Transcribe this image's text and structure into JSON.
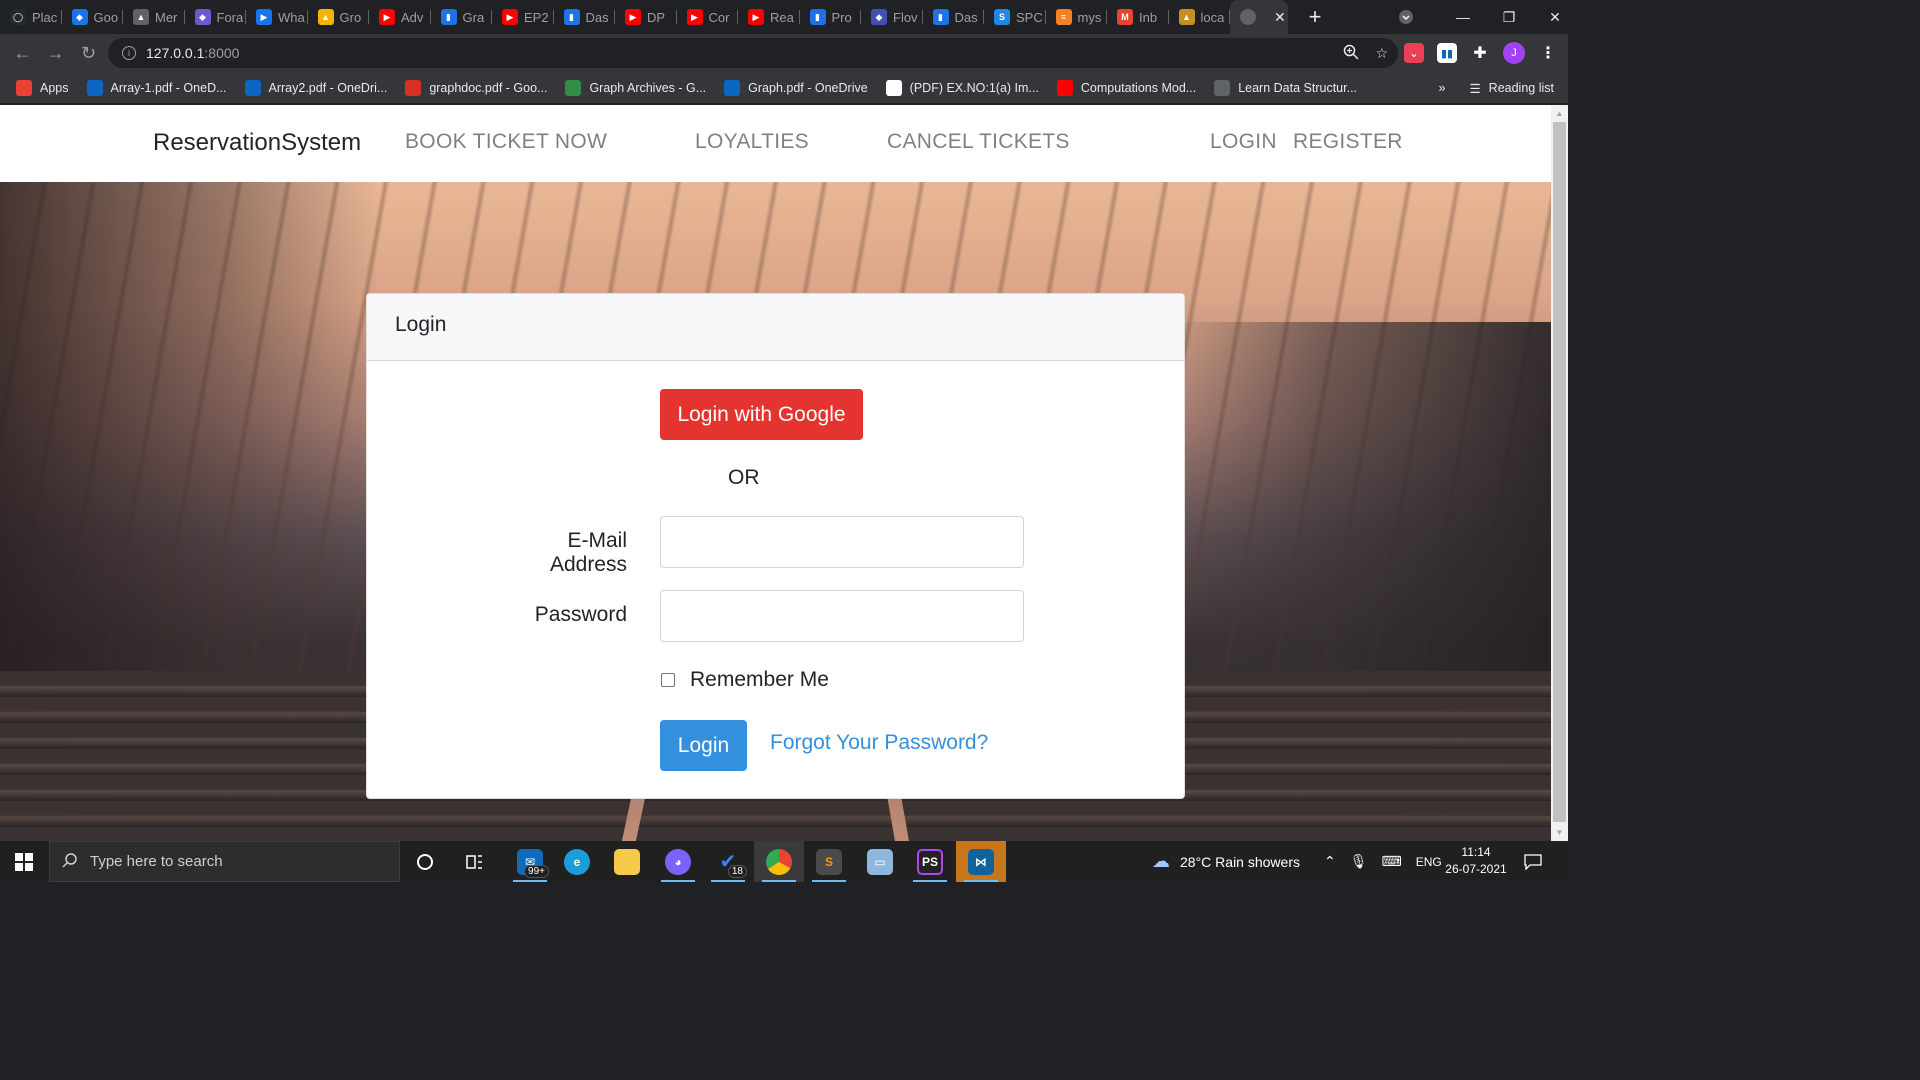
{
  "browser": {
    "tabs": [
      {
        "label": "Plac",
        "color": "#24292e",
        "glyph": "◯",
        "icon": "github-icon"
      },
      {
        "label": "Goo",
        "color": "#1a73e8",
        "glyph": "◆",
        "icon": "google-drive-icon"
      },
      {
        "label": "Mer",
        "color": "#5f6368",
        "glyph": "▲",
        "icon": "mountain-icon"
      },
      {
        "label": "Fora",
        "color": "#6a5acd",
        "glyph": "◆",
        "icon": "shield-icon"
      },
      {
        "label": "Wha",
        "color": "#1a73e8",
        "glyph": "▶",
        "icon": "play-icon"
      },
      {
        "label": "Gro",
        "color": "#f4b400",
        "glyph": "▲",
        "icon": "google-drive-icon"
      },
      {
        "label": "Adv",
        "color": "#ff0000",
        "glyph": "▶",
        "icon": "youtube-icon"
      },
      {
        "label": "Gra",
        "color": "#1a73e8",
        "glyph": "▮",
        "icon": "bar-chart-icon"
      },
      {
        "label": "EP2",
        "color": "#ff0000",
        "glyph": "▶",
        "icon": "youtube-icon"
      },
      {
        "label": "Das",
        "color": "#1a73e8",
        "glyph": "▮",
        "icon": "bar-chart-icon"
      },
      {
        "label": "DP",
        "color": "#ff0000",
        "glyph": "▶",
        "icon": "youtube-icon"
      },
      {
        "label": "Cor",
        "color": "#ff0000",
        "glyph": "▶",
        "icon": "youtube-icon"
      },
      {
        "label": "Rea",
        "color": "#ff0000",
        "glyph": "▶",
        "icon": "youtube-icon"
      },
      {
        "label": "Pro",
        "color": "#1a73e8",
        "glyph": "▮",
        "icon": "bar-chart-icon"
      },
      {
        "label": "Flov",
        "color": "#3f51b5",
        "glyph": "◆",
        "icon": "flow-icon"
      },
      {
        "label": "Das",
        "color": "#1a73e8",
        "glyph": "▮",
        "icon": "bar-chart-icon"
      },
      {
        "label": "SPC",
        "color": "#1e88e5",
        "glyph": "S",
        "icon": "spc-icon"
      },
      {
        "label": "mys",
        "color": "#f48024",
        "glyph": "≡",
        "icon": "stackoverflow-icon"
      },
      {
        "label": "Inb",
        "color": "#ea4335",
        "glyph": "M",
        "icon": "gmail-icon"
      },
      {
        "label": "loca",
        "color": "#c69026",
        "glyph": "▲",
        "icon": "pma-icon"
      }
    ],
    "active_tab_close": "✕",
    "new_tab": "+",
    "url_host": "127.0.0.1",
    "url_port": ":8000",
    "profile_initial": "J",
    "bookmarks": [
      {
        "label": "Apps",
        "color": "#ea4335",
        "icon": "apps-grid-icon"
      },
      {
        "label": "Array-1.pdf - OneD...",
        "color": "#0a66c2",
        "icon": "onedrive-icon"
      },
      {
        "label": "Array2.pdf - OneDri...",
        "color": "#0a66c2",
        "icon": "onedrive-icon"
      },
      {
        "label": "graphdoc.pdf - Goo...",
        "color": "#d93025",
        "icon": "pdf-icon"
      },
      {
        "label": "Graph Archives - G...",
        "color": "#2f8d46",
        "icon": "gfg-icon"
      },
      {
        "label": "Graph.pdf - OneDrive",
        "color": "#0a66c2",
        "icon": "onedrive-icon"
      },
      {
        "label": "(PDF) EX.NO:1(a) Im...",
        "color": "#ffffff",
        "icon": "academia-icon"
      },
      {
        "label": "Computations Mod...",
        "color": "#ff0000",
        "icon": "youtube-icon"
      },
      {
        "label": "Learn Data Structur...",
        "color": "#5f6368",
        "icon": "cc-icon"
      }
    ],
    "bookmarks_overflow": "»",
    "reading_list": "Reading list"
  },
  "site": {
    "brand": "ReservationSystem",
    "nav": {
      "book": "BOOK TICKET NOW",
      "loyalties": "LOYALTIES",
      "cancel": "CANCEL TICKETS",
      "login": "LOGIN",
      "register": "REGISTER"
    },
    "card": {
      "title": "Login",
      "google_button": "Login with Google",
      "or": "OR",
      "email_label": "E-Mail Address",
      "email_value": "",
      "password_label": "Password",
      "password_value": "",
      "remember_label": "Remember Me",
      "remember_checked": false,
      "login_button": "Login",
      "forgot_link": "Forgot Your Password?"
    },
    "colors": {
      "danger": "#e3342f",
      "primary": "#3490dc"
    }
  },
  "taskbar": {
    "search_placeholder": "Type here to search",
    "mail_badge": "99+",
    "todo_badge": "18",
    "weather": "28°C  Rain showers",
    "lang": "ENG",
    "time": "11:14",
    "date": "26-07-2021"
  }
}
